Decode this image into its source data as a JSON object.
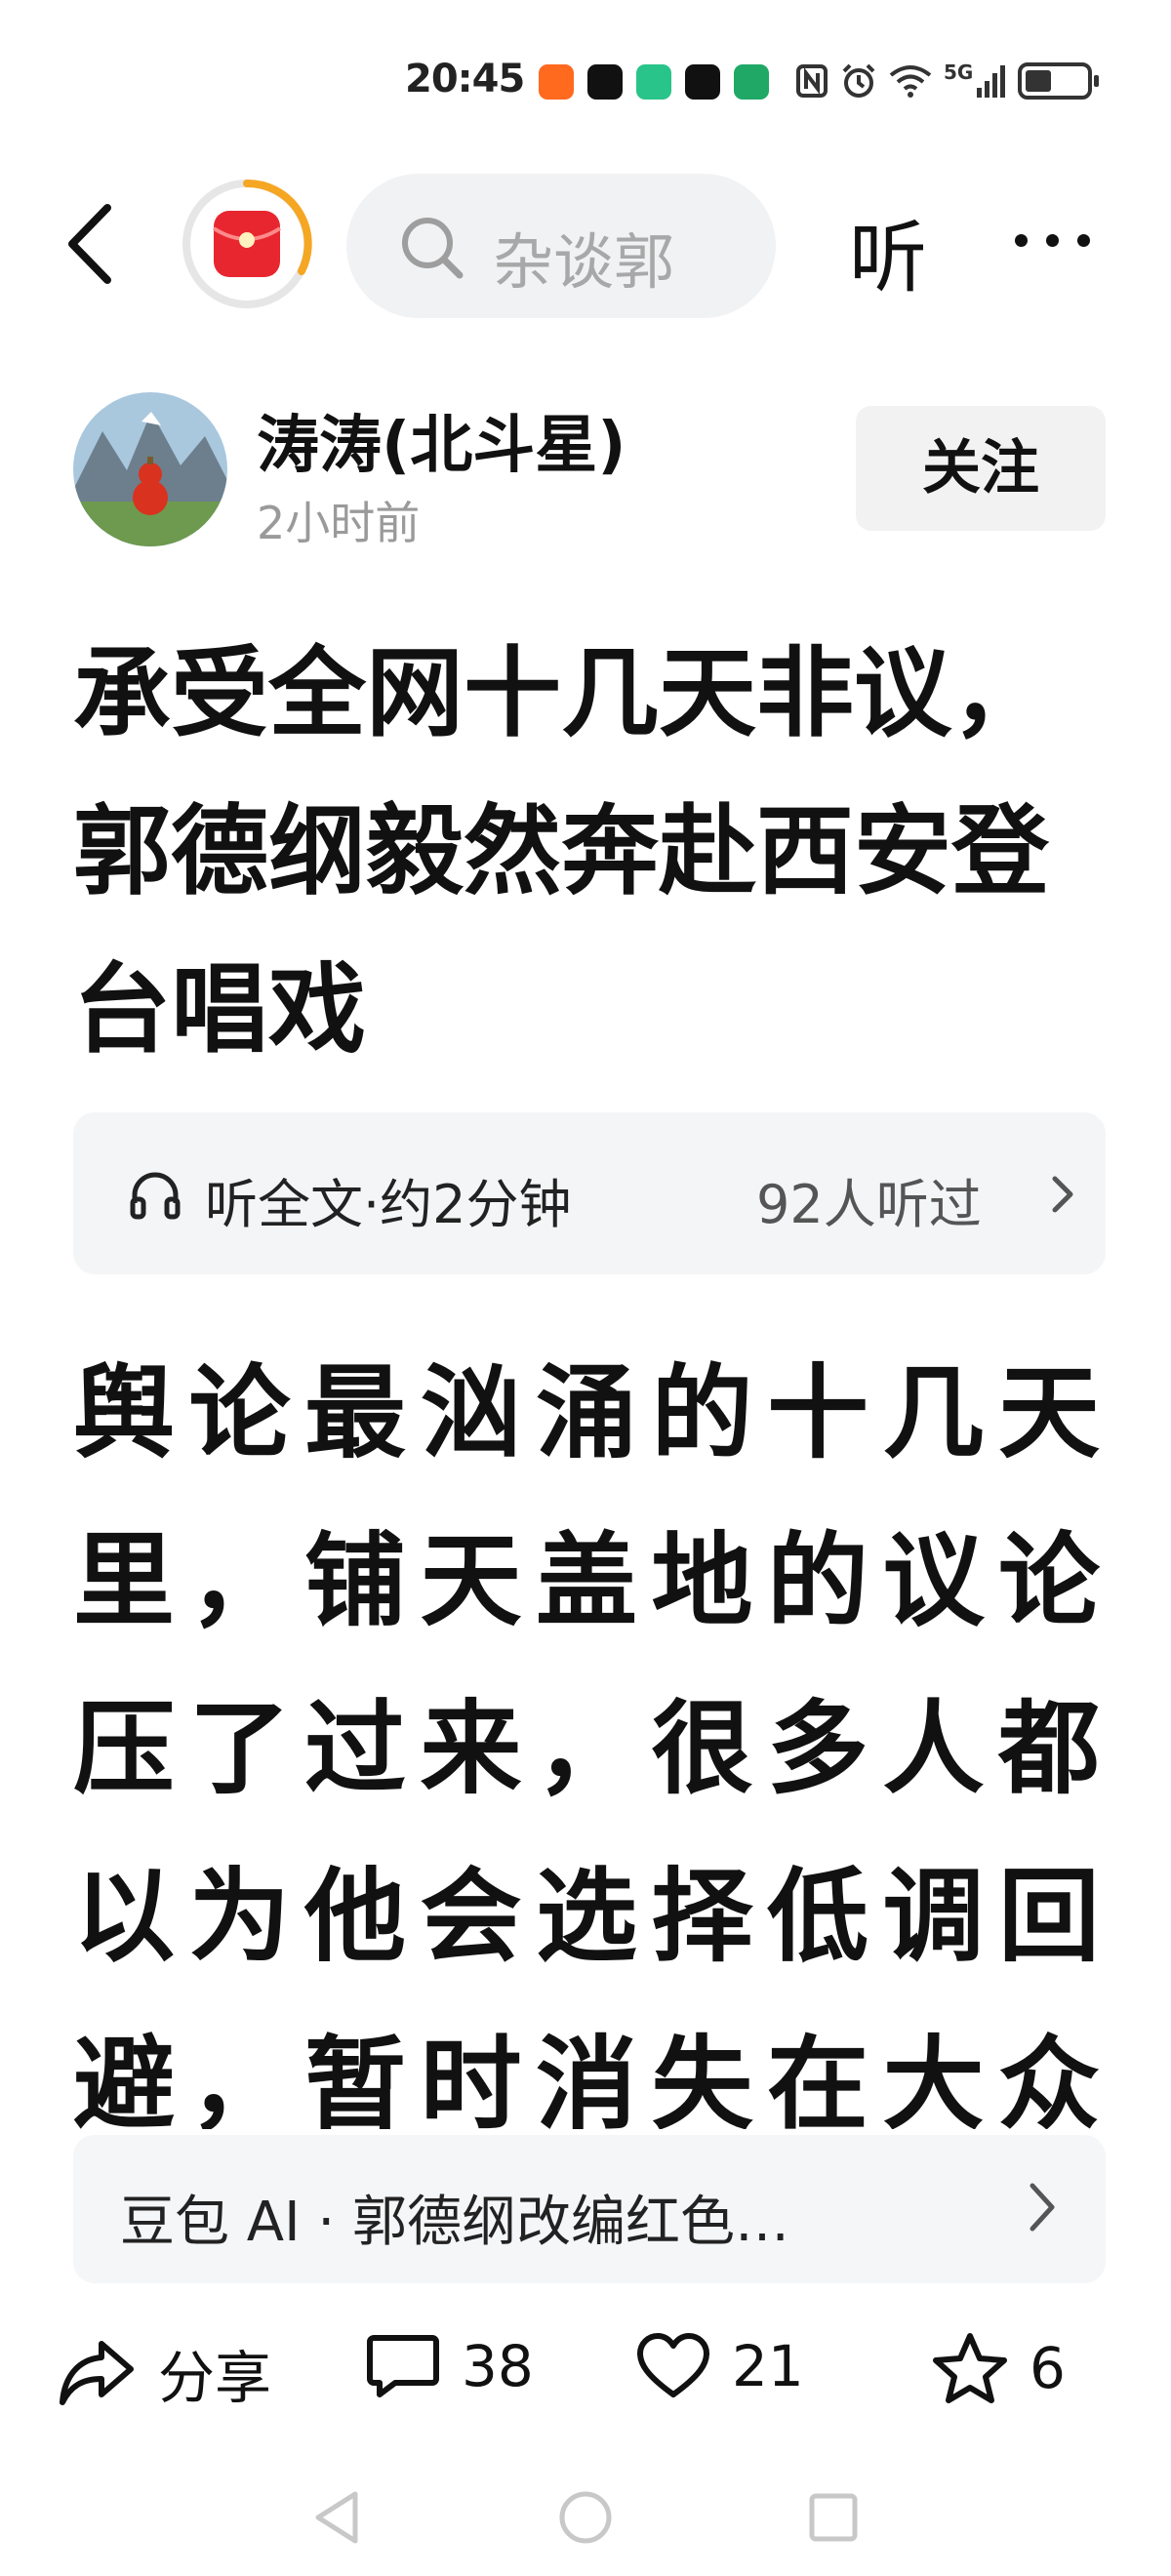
{
  "status_bar": {
    "time": "20:45",
    "network": "5G",
    "battery_percent": 40
  },
  "top_nav": {
    "search_placeholder": "杂谈郭",
    "listen_label": "听"
  },
  "author": {
    "name": "涛涛(北斗星)",
    "time": "2小时前",
    "follow_label": "关注"
  },
  "article": {
    "title": "承受全网十几天非议，郭德纲毅然奔赴西安登台唱戏",
    "listen_label": "听全文·约2分钟",
    "listen_count": "92人听过",
    "body": "舆论最汹涌的十几天里，铺天盖地的议论压了过来，很多人都以为他会选择低调回避，暂时消失在大众视野，可"
  },
  "ai_card": {
    "text": "豆包 AI · 郭德纲改编红色…"
  },
  "actions": {
    "share": "分享",
    "comments": "38",
    "likes": "21",
    "favorites": "6"
  },
  "colors": {
    "accent_red": "#e8262f",
    "accent_orange": "#f5a623",
    "text_primary": "#111111",
    "text_secondary": "#9a9a9a"
  }
}
